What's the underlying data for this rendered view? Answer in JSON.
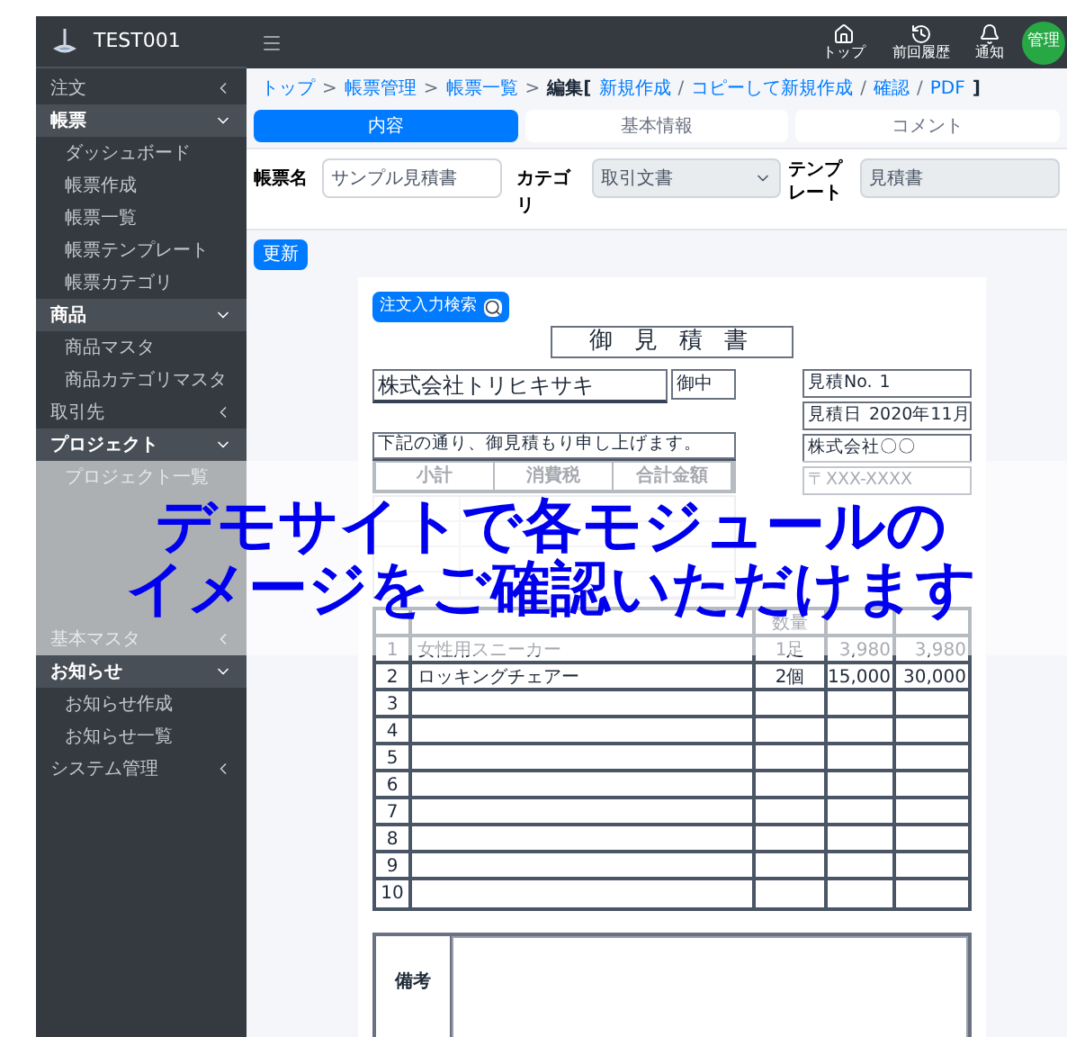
{
  "brand": {
    "name": "TEST001"
  },
  "sidebar": {
    "items": [
      {
        "kind": "section",
        "label": "注文",
        "expanded": false
      },
      {
        "kind": "section",
        "label": "帳票",
        "expanded": true
      },
      {
        "kind": "child",
        "label": "ダッシュボード"
      },
      {
        "kind": "child",
        "label": "帳票作成"
      },
      {
        "kind": "child",
        "label": "帳票一覧"
      },
      {
        "kind": "child",
        "label": "帳票テンプレート"
      },
      {
        "kind": "child",
        "label": "帳票カテゴリ"
      },
      {
        "kind": "section",
        "label": "商品",
        "expanded": true
      },
      {
        "kind": "child",
        "label": "商品マスタ"
      },
      {
        "kind": "child",
        "label": "商品カテゴリマスタ"
      },
      {
        "kind": "section",
        "label": "取引先",
        "expanded": false
      },
      {
        "kind": "section",
        "label": "プロジェクト",
        "expanded": true
      },
      {
        "kind": "child",
        "label": "プロジェクト一覧"
      },
      {
        "kind": "hidden"
      },
      {
        "kind": "hidden"
      },
      {
        "kind": "hidden"
      },
      {
        "kind": "hidden"
      },
      {
        "kind": "section",
        "label": "基本マスタ",
        "expanded": false
      },
      {
        "kind": "section",
        "label": "お知らせ",
        "expanded": true
      },
      {
        "kind": "child",
        "label": "お知らせ作成"
      },
      {
        "kind": "child",
        "label": "お知らせ一覧"
      },
      {
        "kind": "section",
        "label": "システム管理",
        "expanded": false
      }
    ]
  },
  "topbar": {
    "icons": [
      {
        "kind": "home",
        "label": "トップ"
      },
      {
        "kind": "history",
        "label": "前回履歴"
      },
      {
        "kind": "bell",
        "label": "通知"
      }
    ],
    "avatar": "管理"
  },
  "breadcrumb": [
    {
      "kind": "link",
      "text": "トップ"
    },
    {
      "kind": "sep",
      "text": ">"
    },
    {
      "kind": "link",
      "text": "帳票管理"
    },
    {
      "kind": "sep",
      "text": ">"
    },
    {
      "kind": "link",
      "text": "帳票一覧"
    },
    {
      "kind": "sep",
      "text": ">"
    },
    {
      "kind": "current",
      "text": "編集["
    },
    {
      "kind": "link",
      "text": "新規作成"
    },
    {
      "kind": "sep",
      "text": "/"
    },
    {
      "kind": "link",
      "text": "コピーして新規作成"
    },
    {
      "kind": "sep",
      "text": "/"
    },
    {
      "kind": "link",
      "text": "確認"
    },
    {
      "kind": "sep",
      "text": "/"
    },
    {
      "kind": "link",
      "text": "PDF"
    },
    {
      "kind": "current",
      "text": "]"
    }
  ],
  "tabs": [
    {
      "label": "内容",
      "selected": true
    },
    {
      "label": "基本情報",
      "selected": false
    },
    {
      "label": "コメント",
      "selected": false
    }
  ],
  "form": {
    "name_label": "帳票名",
    "name_value": "サンプル見積書",
    "category_label": "カテゴリ",
    "category_value": "取引文書",
    "template_label": "テンプレート",
    "template_value": "見積書"
  },
  "update_button": "更新",
  "document": {
    "search_button": "注文入力検索",
    "title": "御 見 積 書",
    "customer": "株式会社トリヒキサキ",
    "honorific": "御中",
    "info": [
      {
        "label": "見積No.",
        "value": "1"
      },
      {
        "label": "見積日",
        "value": "2020年11月"
      },
      {
        "label": "株式会社〇〇"
      },
      {
        "label": "〒XXX-XXXX"
      }
    ],
    "greeting": "下記の通り、御見積もり申し上げます。",
    "totals": {
      "columns": [
        "小計",
        "消費税",
        "合計金額"
      ]
    },
    "quantity_header": "数量",
    "rows": [
      {
        "no": "1",
        "name": "女性用スニーカー",
        "qty": "1足",
        "price": "3,980",
        "amount": "3,980"
      },
      {
        "no": "2",
        "name": "ロッキングチェアー",
        "qty": "2個",
        "price": "15,000",
        "amount": "30,000"
      },
      {
        "no": "3"
      },
      {
        "no": "4"
      },
      {
        "no": "5"
      },
      {
        "no": "6"
      },
      {
        "no": "7"
      },
      {
        "no": "8"
      },
      {
        "no": "9"
      },
      {
        "no": "10"
      }
    ],
    "remarks_label": "備考"
  },
  "banner": {
    "lines": [
      "デモサイトで各モジュールの",
      "イメージをご確認いただけます"
    ]
  }
}
